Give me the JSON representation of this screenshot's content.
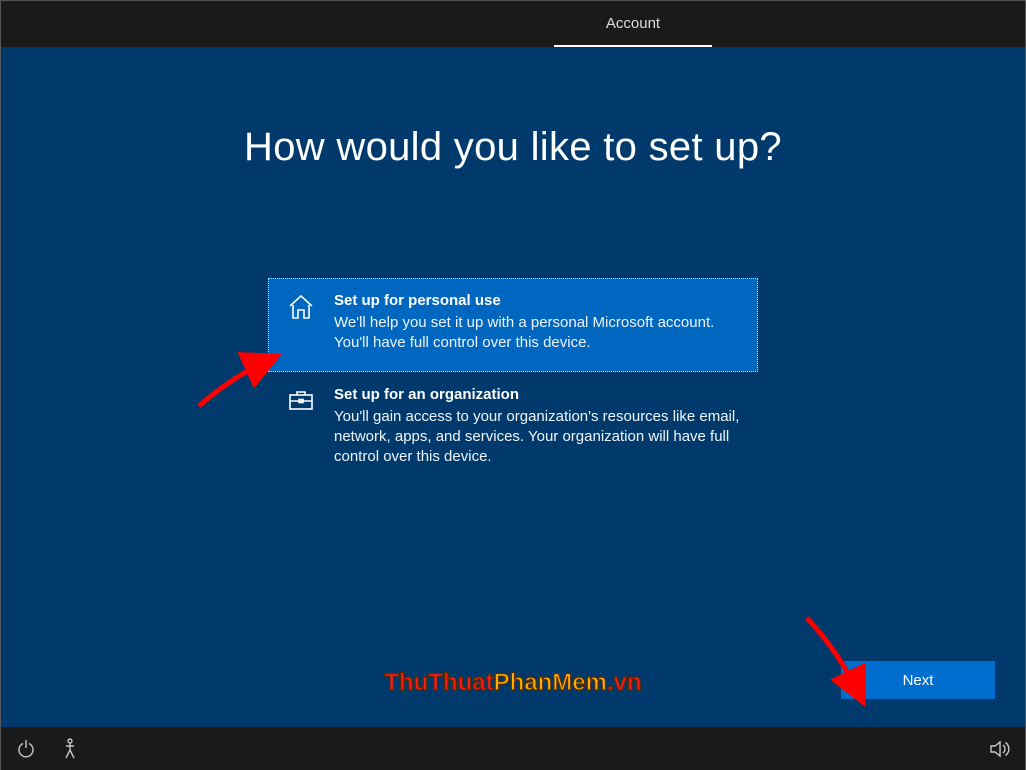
{
  "header": {
    "active_tab": "Account"
  },
  "page": {
    "title": "How would you like to set up?"
  },
  "options": [
    {
      "icon": "home-icon",
      "title": "Set up for personal use",
      "description": "We'll help you set it up with a personal Microsoft account. You'll have full control over this device.",
      "selected": true
    },
    {
      "icon": "briefcase-icon",
      "title": "Set up for an organization",
      "description": "You'll gain access to your organization's resources like email, network, apps, and services. Your organization will have full control over this device.",
      "selected": false
    }
  ],
  "buttons": {
    "next": "Next"
  },
  "watermark": {
    "part1": "ThuThuat",
    "part2": "PhanMem",
    "part3": ".vn"
  },
  "bottom_icons": [
    "power-icon",
    "accessibility-icon",
    "volume-icon"
  ]
}
